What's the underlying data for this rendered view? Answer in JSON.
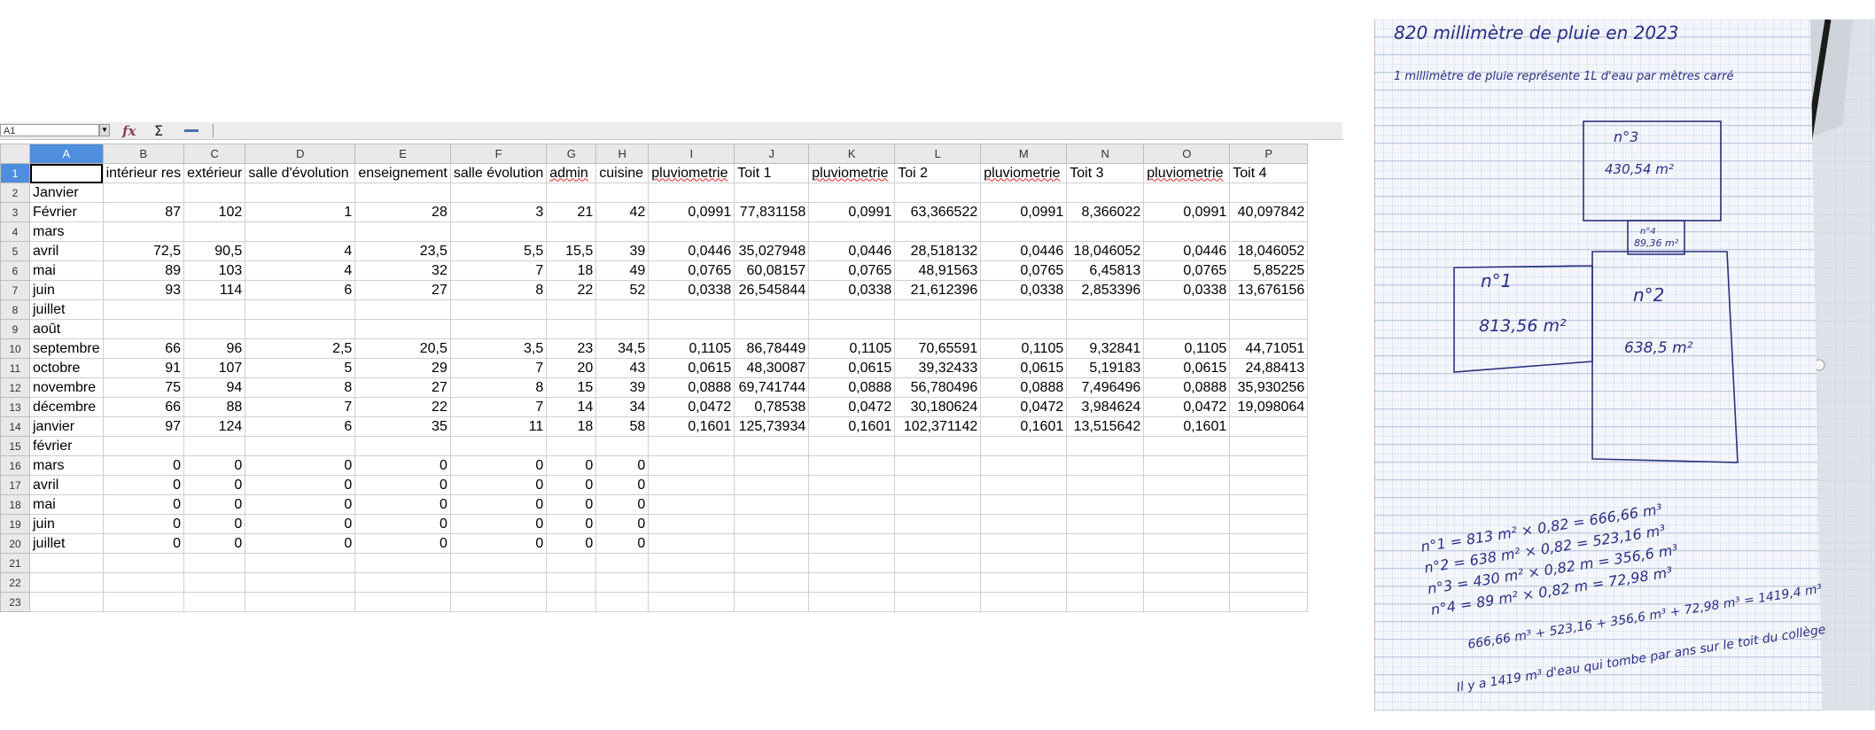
{
  "spreadsheet": {
    "name_box": "A1",
    "columns": [
      "A",
      "B",
      "C",
      "D",
      "E",
      "F",
      "G",
      "H",
      "I",
      "J",
      "K",
      "L",
      "M",
      "N",
      "O",
      "P"
    ],
    "rows": [
      {
        "n": "1",
        "cells": [
          "",
          "intérieur res",
          "extérieur",
          "salle d'évolution",
          "enseignement",
          "salle évolution",
          "admin",
          "cuisine",
          "pluviometrie",
          "Toit 1",
          "pluviometrie",
          "Toi 2",
          "pluviometrie",
          "Toit 3",
          "pluviometrie",
          "Toit 4"
        ]
      },
      {
        "n": "2",
        "cells": [
          "Janvier",
          "",
          "",
          "",
          "",
          "",
          "",
          "",
          "",
          "",
          "",
          "",
          "",
          "",
          "",
          ""
        ]
      },
      {
        "n": "3",
        "cells": [
          "Février",
          "87",
          "102",
          "1",
          "28",
          "3",
          "21",
          "42",
          "0,0991",
          "77,831158",
          "0,0991",
          "63,366522",
          "0,0991",
          "8,366022",
          "0,0991",
          "40,097842"
        ]
      },
      {
        "n": "4",
        "cells": [
          "mars",
          "",
          "",
          "",
          "",
          "",
          "",
          "",
          "",
          "",
          "",
          "",
          "",
          "",
          "",
          ""
        ]
      },
      {
        "n": "5",
        "cells": [
          "avril",
          "72,5",
          "90,5",
          "4",
          "23,5",
          "5,5",
          "15,5",
          "39",
          "0,0446",
          "35,027948",
          "0,0446",
          "28,518132",
          "0,0446",
          "18,046052",
          "0,0446",
          "18,046052"
        ]
      },
      {
        "n": "6",
        "cells": [
          "mai",
          "89",
          "103",
          "4",
          "32",
          "7",
          "18",
          "49",
          "0,0765",
          "60,08157",
          "0,0765",
          "48,91563",
          "0,0765",
          "6,45813",
          "0,0765",
          "5,85225"
        ]
      },
      {
        "n": "7",
        "cells": [
          "juin",
          "93",
          "114",
          "6",
          "27",
          "8",
          "22",
          "52",
          "0,0338",
          "26,545844",
          "0,0338",
          "21,612396",
          "0,0338",
          "2,853396",
          "0,0338",
          "13,676156"
        ]
      },
      {
        "n": "8",
        "cells": [
          "juillet",
          "",
          "",
          "",
          "",
          "",
          "",
          "",
          "",
          "",
          "",
          "",
          "",
          "",
          "",
          ""
        ]
      },
      {
        "n": "9",
        "cells": [
          "août",
          "",
          "",
          "",
          "",
          "",
          "",
          "",
          "",
          "",
          "",
          "",
          "",
          "",
          "",
          ""
        ]
      },
      {
        "n": "10",
        "cells": [
          "septembre",
          "66",
          "96",
          "2,5",
          "20,5",
          "3,5",
          "23",
          "34,5",
          "0,1105",
          "86,78449",
          "0,1105",
          "70,65591",
          "0,1105",
          "9,32841",
          "0,1105",
          "44,71051"
        ]
      },
      {
        "n": "11",
        "cells": [
          "octobre",
          "91",
          "107",
          "5",
          "29",
          "7",
          "20",
          "43",
          "0,0615",
          "48,30087",
          "0,0615",
          "39,32433",
          "0,0615",
          "5,19183",
          "0,0615",
          "24,88413"
        ]
      },
      {
        "n": "12",
        "cells": [
          "novembre",
          "75",
          "94",
          "8",
          "27",
          "8",
          "15",
          "39",
          "0,0888",
          "69,741744",
          "0,0888",
          "56,780496",
          "0,0888",
          "7,496496",
          "0,0888",
          "35,930256"
        ]
      },
      {
        "n": "13",
        "cells": [
          "décembre",
          "66",
          "88",
          "7",
          "22",
          "7",
          "14",
          "34",
          "0,0472",
          "0,78538",
          "0,0472",
          "30,180624",
          "0,0472",
          "3,984624",
          "0,0472",
          "19,098064"
        ]
      },
      {
        "n": "14",
        "cells": [
          "janvier",
          "97",
          "124",
          "6",
          "35",
          "11",
          "18",
          "58",
          "0,1601",
          "125,73934",
          "0,1601",
          "102,371142",
          "0,1601",
          "13,515642",
          "0,1601",
          ""
        ]
      },
      {
        "n": "15",
        "cells": [
          "février",
          "",
          "",
          "",
          "",
          "",
          "",
          "",
          "",
          "",
          "",
          "",
          "",
          "",
          "",
          ""
        ]
      },
      {
        "n": "16",
        "cells": [
          "mars",
          "0",
          "0",
          "0",
          "0",
          "0",
          "0",
          "0",
          "",
          "",
          "",
          "",
          "",
          "",
          "",
          ""
        ]
      },
      {
        "n": "17",
        "cells": [
          "avril",
          "0",
          "0",
          "0",
          "0",
          "0",
          "0",
          "0",
          "",
          "",
          "",
          "",
          "",
          "",
          "",
          ""
        ]
      },
      {
        "n": "18",
        "cells": [
          "mai",
          "0",
          "0",
          "0",
          "0",
          "0",
          "0",
          "0",
          "",
          "",
          "",
          "",
          "",
          "",
          "",
          ""
        ]
      },
      {
        "n": "19",
        "cells": [
          "juin",
          "0",
          "0",
          "0",
          "0",
          "0",
          "0",
          "0",
          "",
          "",
          "",
          "",
          "",
          "",
          "",
          ""
        ]
      },
      {
        "n": "20",
        "cells": [
          "juillet",
          "0",
          "0",
          "0",
          "0",
          "0",
          "0",
          "0",
          "",
          "",
          "",
          "",
          "",
          "",
          "",
          ""
        ]
      },
      {
        "n": "21",
        "cells": [
          "",
          "",
          "",
          "",
          "",
          "",
          "",
          "",
          "",
          "",
          "",
          "",
          "",
          "",
          "",
          ""
        ]
      },
      {
        "n": "22",
        "cells": [
          "",
          "",
          "",
          "",
          "",
          "",
          "",
          "",
          "",
          "",
          "",
          "",
          "",
          "",
          "",
          ""
        ]
      },
      {
        "n": "23",
        "cells": [
          "",
          "",
          "",
          "",
          "",
          "",
          "",
          "",
          "",
          "",
          "",
          "",
          "",
          "",
          "",
          ""
        ]
      }
    ]
  },
  "notes": {
    "title": "820 millimètre de pluie en 2023",
    "subtitle": "1 millimètre de pluie représente 1L d'eau par mètres carré",
    "room3_label": "n°3",
    "room3_area": "430,54 m²",
    "room4_label": "n°4",
    "room4_area": "89,36 m²",
    "room1_label": "n°1",
    "room1_area": "813,56 m²",
    "room2_label": "n°2",
    "room2_area": "638,5 m²",
    "calc1": "n°1 = 813 m² × 0,82 = 666,66 m³",
    "calc2": "n°2 = 638 m² × 0,82 = 523,16 m³",
    "calc3": "n°3 = 430 m² × 0,82 m = 356,6 m³",
    "calc4": "n°4 = 89 m² × 0,82 m = 72,98 m³",
    "sum": "666,66 m³ + 523,16 + 356,6 m³ + 72,98 m³ = 1419,4 m³",
    "conclusion": "Il y a 1419 m³ d'eau qui tombe par ans sur le toit du collège"
  },
  "colors": {
    "selection": "#4f8edc",
    "ink": "#2b2f86"
  }
}
